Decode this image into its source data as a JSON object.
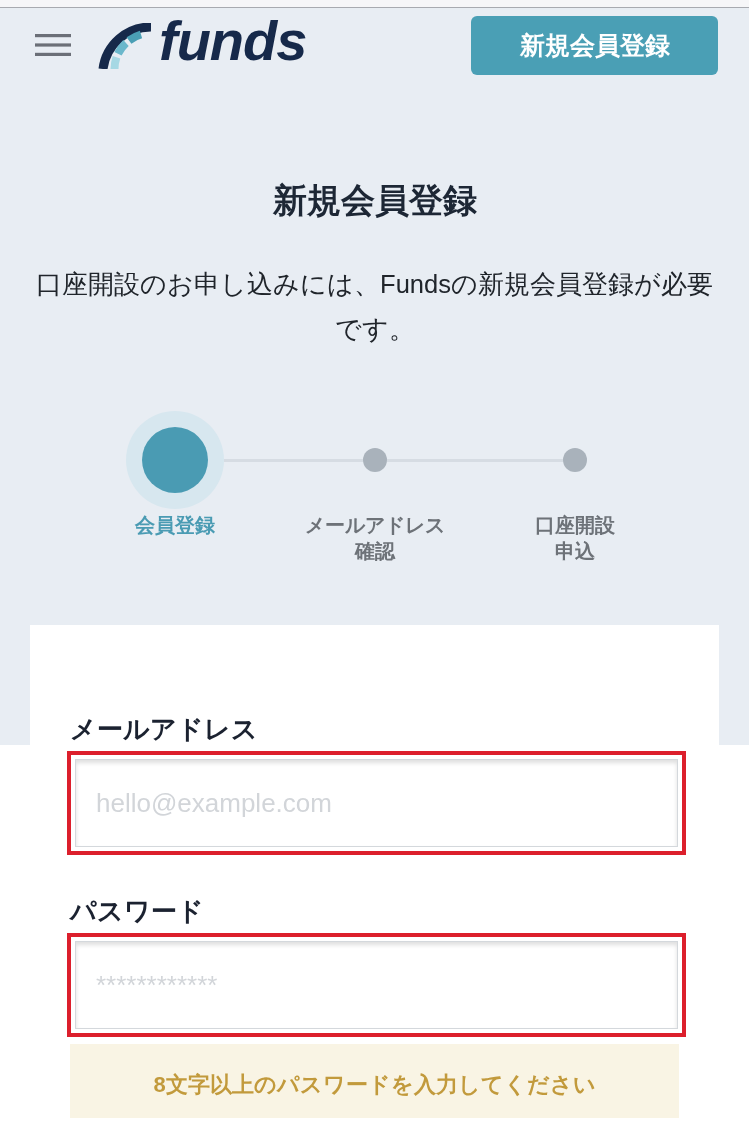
{
  "header": {
    "logo": {
      "text": "funds"
    },
    "signup_button": "新規会員登録"
  },
  "page_title": "新規会員登録",
  "intro": "口座開設のお申し込みには、Fundsの新規会員登録が必要です。",
  "steps": [
    {
      "label_lines": [
        "会員登録"
      ],
      "selected": true
    },
    {
      "label_lines": [
        "メールアドレス",
        "確認"
      ],
      "selected": false
    },
    {
      "label_lines": [
        "口座開設",
        "申込"
      ],
      "selected": false
    }
  ],
  "form": {
    "fields": [
      {
        "label": "メールアドレス",
        "placeholder": "hello@example.com",
        "highlighted": true
      },
      {
        "label": "パスワード",
        "placeholder": "************",
        "highlighted": true
      }
    ],
    "hint": "8文字以上のパスワードを入力してください"
  }
}
